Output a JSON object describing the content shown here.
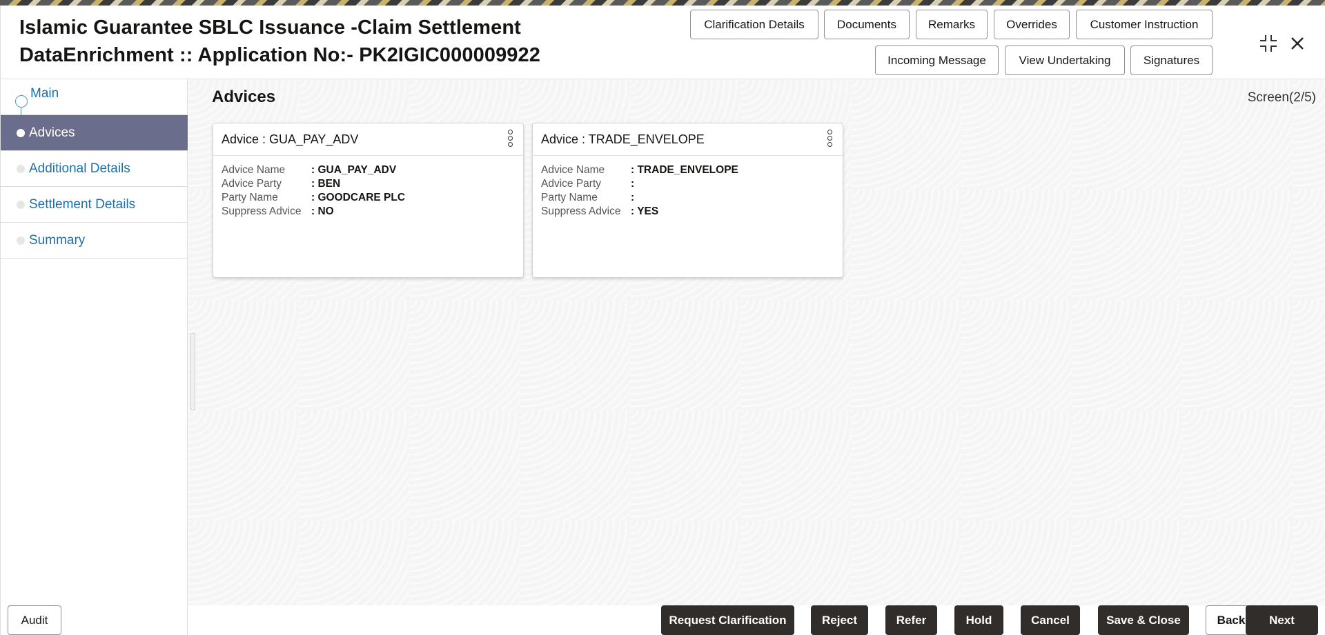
{
  "header": {
    "title_line1": "Islamic Guarantee SBLC Issuance -Claim Settlement",
    "title_line2": "DataEnrichment :: Application No:- PK2IGIC000009922",
    "buttons_row1": [
      "Clarification Details",
      "Documents",
      "Remarks",
      "Overrides",
      "Customer Instruction"
    ],
    "buttons_row2": [
      "Incoming Message",
      "View Undertaking",
      "Signatures"
    ],
    "minimize_icon": "collapse-icon",
    "close_icon": "close-icon"
  },
  "sidebar": {
    "items": [
      {
        "label": "Main",
        "state": "completed"
      },
      {
        "label": "Advices",
        "state": "active"
      },
      {
        "label": "Additional Details",
        "state": "pending"
      },
      {
        "label": "Settlement Details",
        "state": "pending"
      },
      {
        "label": "Summary",
        "state": "pending"
      }
    ]
  },
  "main": {
    "section_title": "Advices",
    "screen_counter": "Screen(2/5)",
    "cards": [
      {
        "title": "Advice : GUA_PAY_ADV",
        "fields": [
          {
            "label": "Advice Name",
            "value": ": GUA_PAY_ADV"
          },
          {
            "label": "Advice Party",
            "value": ": BEN"
          },
          {
            "label": "Party Name",
            "value": ": GOODCARE PLC"
          },
          {
            "label": "Suppress Advice",
            "value": ": NO"
          }
        ]
      },
      {
        "title": "Advice : TRADE_ENVELOPE",
        "fields": [
          {
            "label": "Advice Name",
            "value": ": TRADE_ENVELOPE"
          },
          {
            "label": "Advice Party",
            "value": ":"
          },
          {
            "label": "Party Name",
            "value": ":"
          },
          {
            "label": "Suppress Advice",
            "value": ": YES"
          }
        ]
      }
    ]
  },
  "footer": {
    "audit": "Audit",
    "request_clarification": "Request Clarification",
    "reject": "Reject",
    "refer": "Refer",
    "hold": "Hold",
    "cancel": "Cancel",
    "save_close": "Save & Close",
    "back": "Back",
    "next": "Next"
  },
  "colors": {
    "active_nav": "#6a6e8c",
    "link": "#1d6fa5",
    "dark_button": "#312d2a"
  }
}
